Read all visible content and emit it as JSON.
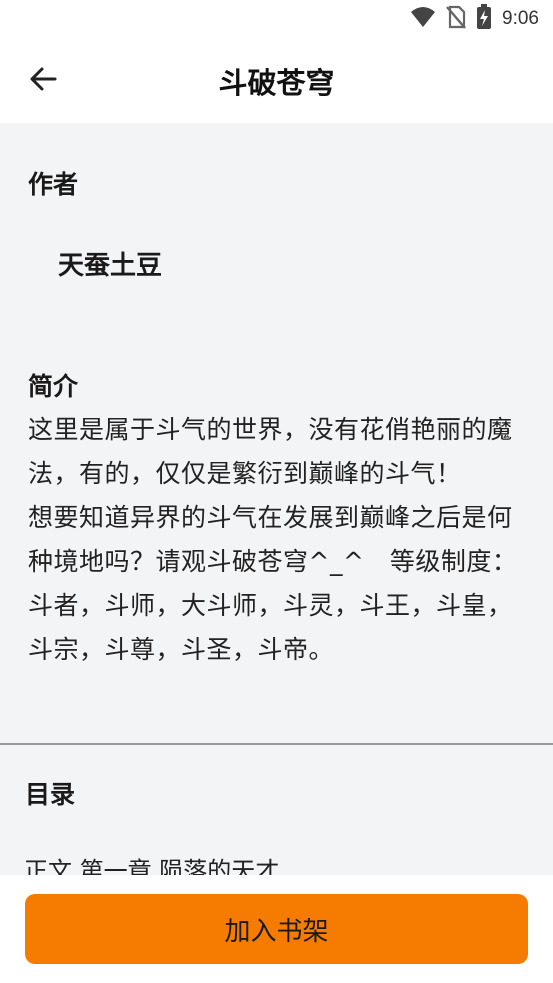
{
  "status_bar": {
    "time": "9:06",
    "icons": [
      "wifi-icon",
      "no-sim-icon",
      "battery-charging-icon"
    ]
  },
  "app_bar": {
    "back_icon": "arrow-left-icon",
    "title": "斗破苍穹"
  },
  "book": {
    "author_label": "作者",
    "author": "天蚕土豆",
    "intro_label": "简介",
    "intro": "这里是属于斗气的世界，没有花俏艳丽的魔法，有的，仅仅是繁衍到巅峰的斗气！　　想要知道异界的斗气在发展到巅峰之后是何种境地吗？请观斗破苍穹^_^　等级制度：斗者，斗师，大斗师，斗灵，斗王，斗皇，斗宗，斗尊，斗圣，斗帝。",
    "catalog_label": "目录",
    "first_chapter": "正文 第一章 陨落的天才"
  },
  "bottom": {
    "add_to_shelf_label": "加入书架"
  },
  "colors": {
    "accent": "#f57c00",
    "content_bg": "#f3f4f6"
  }
}
